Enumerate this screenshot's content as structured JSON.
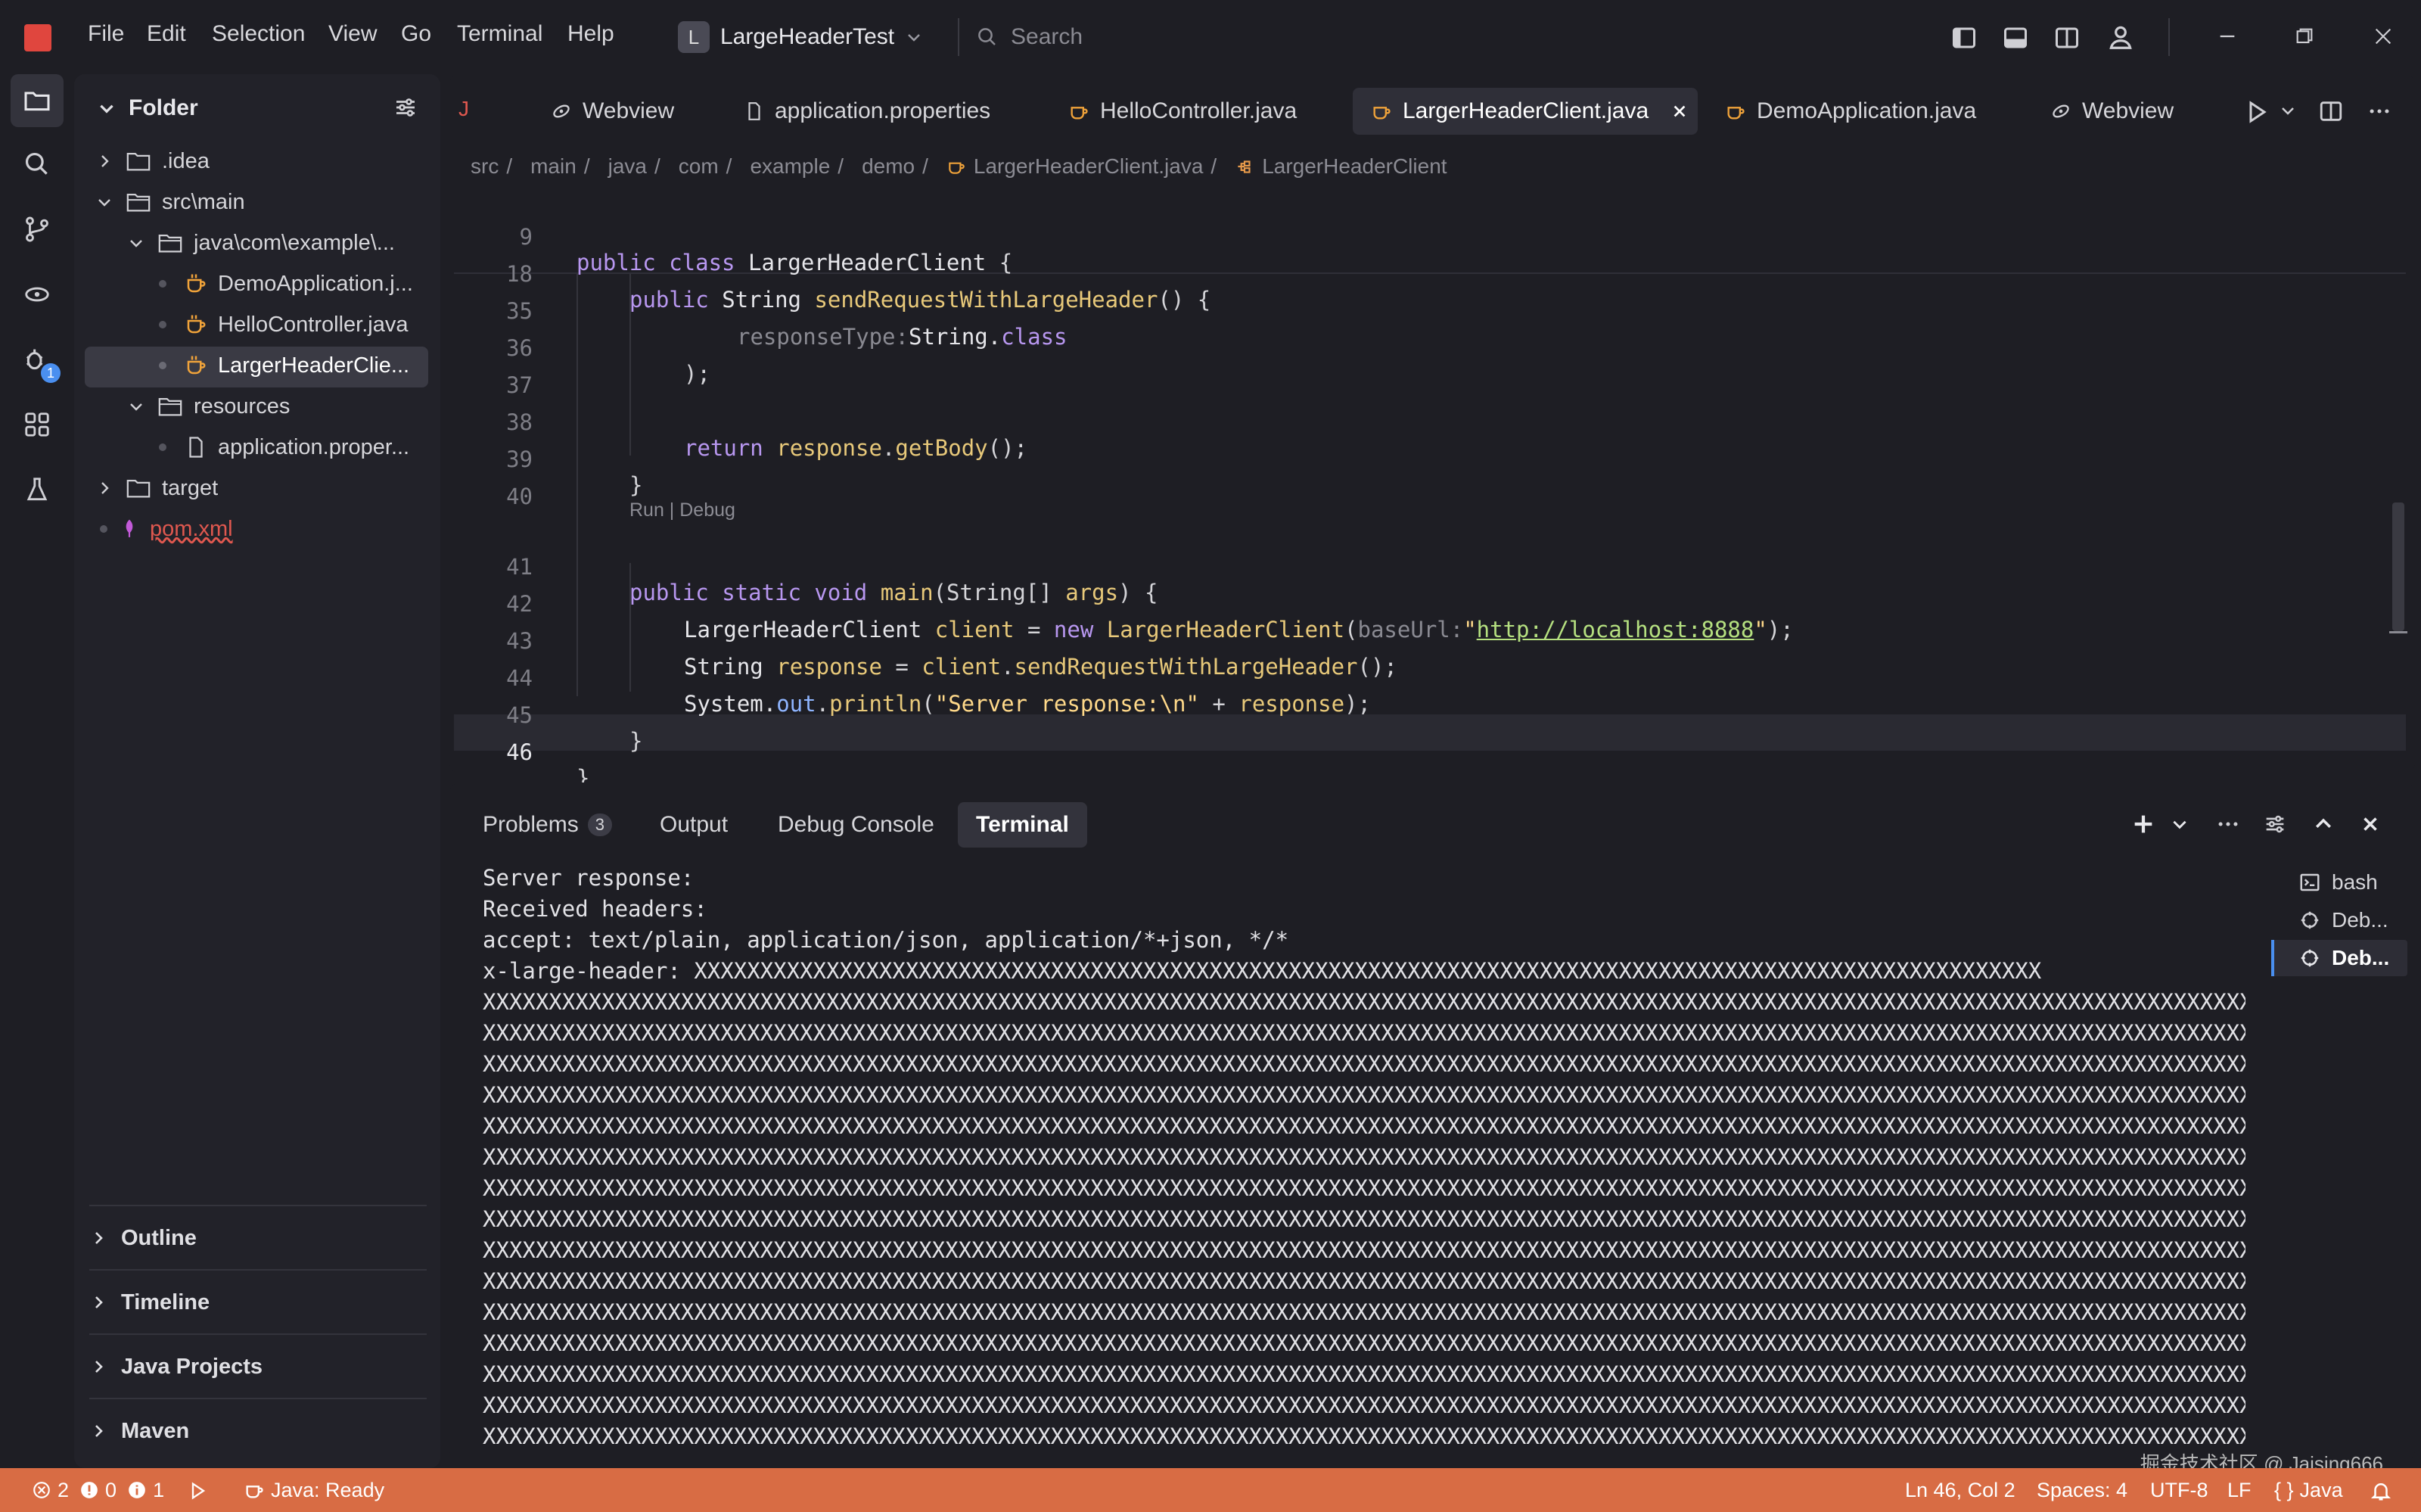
{
  "menu": [
    "File",
    "Edit",
    "Selection",
    "View",
    "Go",
    "Terminal",
    "Help"
  ],
  "project": {
    "badge": "L",
    "name": "LargeHeaderTest"
  },
  "search": {
    "placeholder": "Search"
  },
  "sidebar": {
    "title": "Folder",
    "tree": [
      {
        "label": ".idea"
      },
      {
        "label": "src\\main"
      },
      {
        "label": "java\\com\\example\\..."
      },
      {
        "label": "DemoApplication.j..."
      },
      {
        "label": "HelloController.java"
      },
      {
        "label": "LargerHeaderClie..."
      },
      {
        "label": "resources"
      },
      {
        "label": "application.proper..."
      },
      {
        "label": "target"
      },
      {
        "label": "pom.xml"
      }
    ],
    "panels": [
      "Outline",
      "Timeline",
      "Java Projects",
      "Maven"
    ]
  },
  "activity": {
    "debug_badge": "1"
  },
  "tabs": [
    {
      "label": "Webview"
    },
    {
      "label": "application.properties"
    },
    {
      "label": "HelloController.java"
    },
    {
      "label": "LargerHeaderClient.java"
    },
    {
      "label": "DemoApplication.java"
    },
    {
      "label": "Webview"
    }
  ],
  "breadcrumb": [
    "src",
    "main",
    "java",
    "com",
    "example",
    "demo",
    "LargerHeaderClient.java",
    "LargerHeaderClient"
  ],
  "editor": {
    "codelens": "Run | Debug",
    "lines": [
      {
        "n": "9"
      },
      {
        "n": "18"
      },
      {
        "n": "35"
      },
      {
        "n": "36"
      },
      {
        "n": "37"
      },
      {
        "n": "38"
      },
      {
        "n": "39"
      },
      {
        "n": "40"
      },
      {
        "n": "41"
      },
      {
        "n": "42"
      },
      {
        "n": "43"
      },
      {
        "n": "44"
      },
      {
        "n": "45"
      },
      {
        "n": "46"
      }
    ],
    "code": {
      "l9_kw": "public class",
      "l9_name": "LargerHeaderClient",
      "l9_rest": " {",
      "l18_kw": "public",
      "l18_type": "String",
      "l18_fn": "sendRequestWithLargeHeader",
      "l18_rest": "() {",
      "l35_hint": "responseType:",
      "l35_type": "String.",
      "l35_kw": "class",
      "l36": ");",
      "l38_kw": "return",
      "l38_var": "response",
      "l38_fn": "getBody",
      "l38_rest": "();",
      "l39": "}",
      "l41_kw": "public static void",
      "l41_fn": "main",
      "l41_a": "(String[] ",
      "l41_arg": "args",
      "l41_rest": ") {",
      "l42_type": "LargerHeaderClient",
      "l42_var": "client",
      "l42_eq": " = ",
      "l42_kw": "new",
      "l42_fn": "LargerHeaderClient",
      "l42_hint": "baseUrl:",
      "l42_q1": "\"",
      "l42_url": "http://localhost:8888",
      "l42_q2": "\"",
      "l42_rest": ");",
      "l43_type": "String",
      "l43_var": "response",
      "l43_eq": " = ",
      "l43_obj": "client",
      "l43_fn": "sendRequestWithLargeHeader",
      "l43_rest": "();",
      "l44_sys": "System.",
      "l44_out": "out",
      "l44_fn": "println",
      "l44_str": "\"Server response:\\n\"",
      "l44_plus": " + ",
      "l44_var": "response",
      "l44_rest": ");",
      "l45": "}",
      "l46": "}"
    }
  },
  "panel": {
    "tabs": [
      {
        "label": "Problems",
        "count": "3"
      },
      {
        "label": "Output"
      },
      {
        "label": "Debug Console"
      },
      {
        "label": "Terminal"
      }
    ],
    "terminal_lines": [
      "Server response:",
      "Received headers:",
      "accept: text/plain, application/json, application/*+json, */*",
      "x-large-header: XXXXXXXXXXXXXXXXXXXXXXXXXXXXXXXXXXXXXXXXXXXXXXXXXXXXXXXXXXXXXXXXXXXXXXXXXXXXXXXXXXXXXXXXXXXXXXXXXXXXXX",
      "XXXXXXXXXXXXXXXXXXXXXXXXXXXXXXXXXXXXXXXXXXXXXXXXXXXXXXXXXXXXXXXXXXXXXXXXXXXXXXXXXXXXXXXXXXXXXXXXXXXXXXXXXXXXXXXXXXXXXXXXXXXXXXXXXXXXXXXXXXXXXXXX",
      "XXXXXXXXXXXXXXXXXXXXXXXXXXXXXXXXXXXXXXXXXXXXXXXXXXXXXXXXXXXXXXXXXXXXXXXXXXXXXXXXXXXXXXXXXXXXXXXXXXXXXXXXXXXXXXXXXXXXXXXXXXXXXXXXXXXXXXXXXXXXXXXX",
      "XXXXXXXXXXXXXXXXXXXXXXXXXXXXXXXXXXXXXXXXXXXXXXXXXXXXXXXXXXXXXXXXXXXXXXXXXXXXXXXXXXXXXXXXXXXXXXXXXXXXXXXXXXXXXXXXXXXXXXXXXXXXXXXXXXXXXXXXXXXXXXXX",
      "XXXXXXXXXXXXXXXXXXXXXXXXXXXXXXXXXXXXXXXXXXXXXXXXXXXXXXXXXXXXXXXXXXXXXXXXXXXXXXXXXXXXXXXXXXXXXXXXXXXXXXXXXXXXXXXXXXXXXXXXXXXXXXXXXXXXXXXXXXXXXXXX",
      "XXXXXXXXXXXXXXXXXXXXXXXXXXXXXXXXXXXXXXXXXXXXXXXXXXXXXXXXXXXXXXXXXXXXXXXXXXXXXXXXXXXXXXXXXXXXXXXXXXXXXXXXXXXXXXXXXXXXXXXXXXXXXXXXXXXXXXXXXXXXXXXX",
      "XXXXXXXXXXXXXXXXXXXXXXXXXXXXXXXXXXXXXXXXXXXXXXXXXXXXXXXXXXXXXXXXXXXXXXXXXXXXXXXXXXXXXXXXXXXXXXXXXXXXXXXXXXXXXXXXXXXXXXXXXXXXXXXXXXXXXXXXXXXXXXXX",
      "XXXXXXXXXXXXXXXXXXXXXXXXXXXXXXXXXXXXXXXXXXXXXXXXXXXXXXXXXXXXXXXXXXXXXXXXXXXXXXXXXXXXXXXXXXXXXXXXXXXXXXXXXXXXXXXXXXXXXXXXXXXXXXXXXXXXXXXXXXXXXXXX",
      "XXXXXXXXXXXXXXXXXXXXXXXXXXXXXXXXXXXXXXXXXXXXXXXXXXXXXXXXXXXXXXXXXXXXXXXXXXXXXXXXXXXXXXXXXXXXXXXXXXXXXXXXXXXXXXXXXXXXXXXXXXXXXXXXXXXXXXXXXXXXXXXX",
      "XXXXXXXXXXXXXXXXXXXXXXXXXXXXXXXXXXXXXXXXXXXXXXXXXXXXXXXXXXXXXXXXXXXXXXXXXXXXXXXXXXXXXXXXXXXXXXXXXXXXXXXXXXXXXXXXXXXXXXXXXXXXXXXXXXXXXXXXXXXXXXXX",
      "XXXXXXXXXXXXXXXXXXXXXXXXXXXXXXXXXXXXXXXXXXXXXXXXXXXXXXXXXXXXXXXXXXXXXXXXXXXXXXXXXXXXXXXXXXXXXXXXXXXXXXXXXXXXXXXXXXXXXXXXXXXXXXXXXXXXXXXXXXXXXXXX",
      "XXXXXXXXXXXXXXXXXXXXXXXXXXXXXXXXXXXXXXXXXXXXXXXXXXXXXXXXXXXXXXXXXXXXXXXXXXXXXXXXXXXXXXXXXXXXXXXXXXXXXXXXXXXXXXXXXXXXXXXXXXXXXXXXXXXXXXXXXXXXXXXX",
      "XXXXXXXXXXXXXXXXXXXXXXXXXXXXXXXXXXXXXXXXXXXXXXXXXXXXXXXXXXXXXXXXXXXXXXXXXXXXXXXXXXXXXXXXXXXXXXXXXXXXXXXXXXXXXXXXXXXXXXXXXXXXXXXXXXXXXXXXXXXXXXXX",
      "XXXXXXXXXXXXXXXXXXXXXXXXXXXXXXXXXXXXXXXXXXXXXXXXXXXXXXXXXXXXXXXXXXXXXXXXXXXXXXXXXXXXXXXXXXXXXXXXXXXXXXXXXXXXXXXXXXXXXXXXXXXXXXXXXXXXXXXXXXXXXXXX",
      "XXXXXXXXXXXXXXXXXXXXXXXXXXXXXXXXXXXXXXXXXXXXXXXXXXXXXXXXXXXXXXXXXXXXXXXXXXXXXXXXXXXXXXXXXXXXXXXXXXXXXXXXXXXXXXXXXXXXXXXXXXXXXXXXXXXXXXXXXXXXXXXX",
      "XXXXXXXXXXXXXXXXXXXXXXXXXXXXXXXXXXXXXXXXXXXXXXXXXXXXXXXXXXXXXXXXXXXXXXXXXXXXXXXXXXXXXXXXXXXXXXXXXXXXXXXXXXXXXXXXXXXXXXXXXXXXXXXXXXXXXXXXXXXXXXXX"
    ],
    "terminals": [
      {
        "label": "bash"
      },
      {
        "label": "Deb..."
      },
      {
        "label": "Deb..."
      }
    ]
  },
  "status": {
    "errors": "2",
    "warnings": "0",
    "infos": "1",
    "java": "Java: Ready",
    "position": "Ln 46, Col 2",
    "spaces": "Spaces: 4",
    "encoding": "UTF-8",
    "eol": "LF",
    "language": "Java"
  },
  "watermark": "掘金技术社区 @ Jaising666",
  "colors": {
    "accent": "#d86c44",
    "background": "#1e1e24",
    "keyword": "#b897f0",
    "function": "#e8c97a",
    "url": "#b5e080"
  }
}
